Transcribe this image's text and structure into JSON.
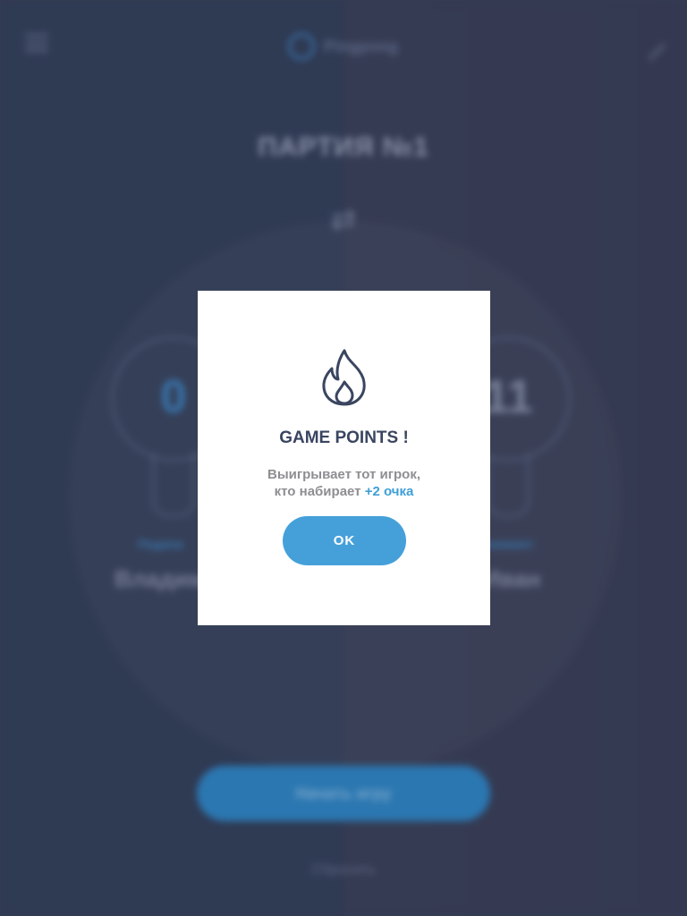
{
  "background": {
    "logo_text": "Pingpong",
    "match_title": "ПАРТИЯ №1",
    "players": [
      {
        "role": "Подача",
        "name": "Владимир",
        "score": "0"
      },
      {
        "role": "Принимает",
        "name": "Иван",
        "score": "11"
      }
    ],
    "start_button": "Начать игру",
    "link_text": "Сбросить"
  },
  "modal": {
    "icon": "fire-icon",
    "title": "GAME POINTS !",
    "line1": "Выигрывает тот игрок,",
    "line2_prefix": "кто набирает ",
    "line2_accent": "+2 очка",
    "ok_label": "OK"
  },
  "colors": {
    "accent": "#45a0da",
    "background": "#3a4258",
    "title": "#3a4560"
  }
}
